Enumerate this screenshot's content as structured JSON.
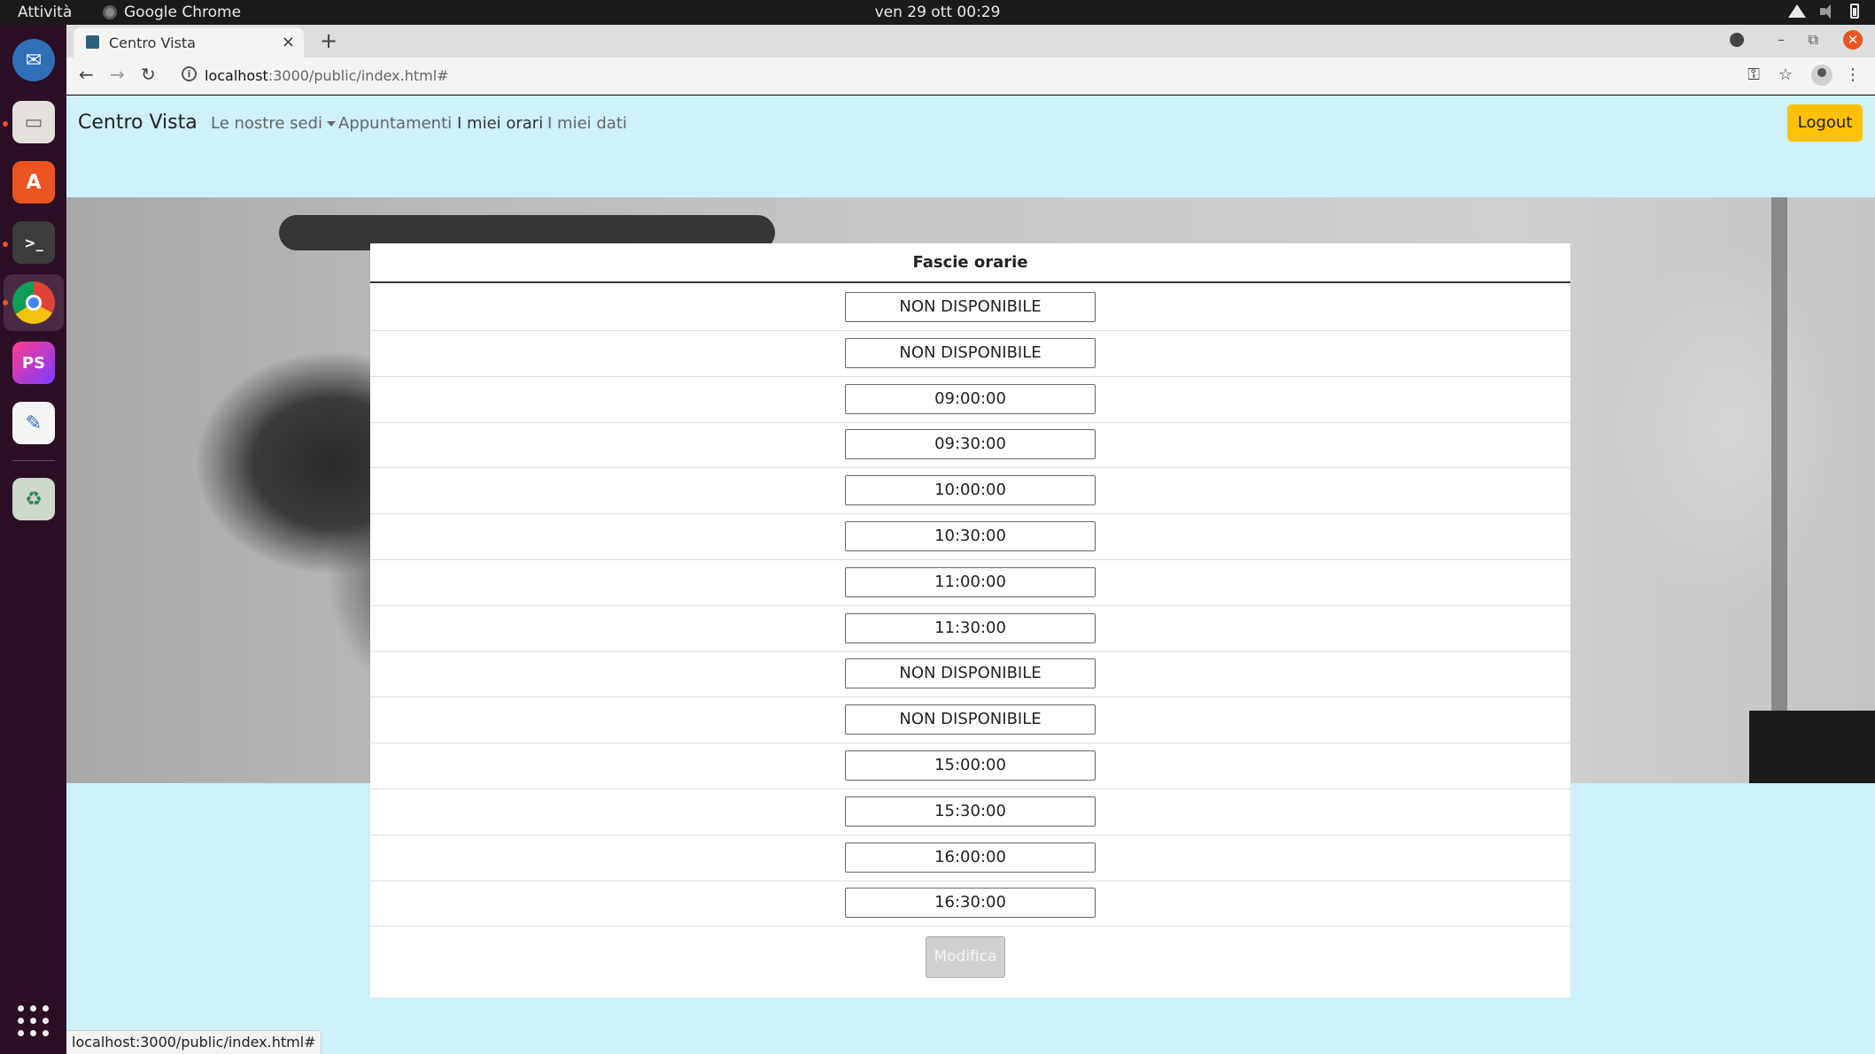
{
  "topbar": {
    "activities": "Attività",
    "app_name": "Google Chrome",
    "clock": "ven 29 ott  00:29"
  },
  "dock": {
    "apps": [
      "thunderbird-icon",
      "files-icon",
      "software-icon",
      "terminal-icon",
      "chrome-icon",
      "phpstorm-icon",
      "text-editor-icon",
      "trash-icon"
    ]
  },
  "browser": {
    "tab_title": "Centro Vista",
    "tab_close": "×",
    "new_tab": "+",
    "url_host": "localhost",
    "url_path": ":3000/public/index.html#",
    "status_url": "localhost:3000/public/index.html#"
  },
  "navbar": {
    "brand": "Centro Vista",
    "links": [
      "Le nostre sedi",
      "Appuntamenti",
      "I miei orari",
      "I miei dati"
    ],
    "logout": "Logout"
  },
  "schedule": {
    "header": "Fascie orarie",
    "slots": [
      "NON DISPONIBILE",
      "NON DISPONIBILE",
      "09:00:00",
      "09:30:00",
      "10:00:00",
      "10:30:00",
      "11:00:00",
      "11:30:00",
      "NON DISPONIBILE",
      "NON DISPONIBILE",
      "15:00:00",
      "15:30:00",
      "16:00:00",
      "16:30:00"
    ],
    "submit_label": "Modifica"
  }
}
